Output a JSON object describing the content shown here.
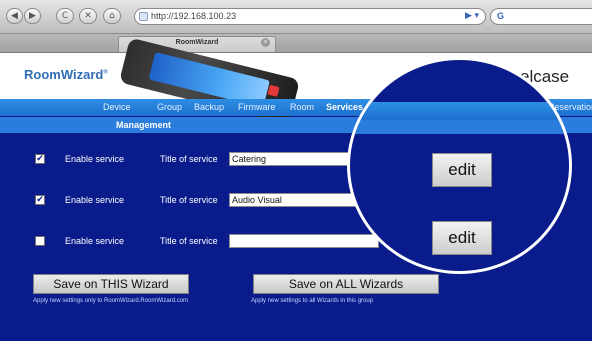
{
  "browser": {
    "back_glyph": "◀",
    "forward_glyph": "▶",
    "reload_glyph": "C",
    "stop_glyph": "✕",
    "home_glyph": "⌂",
    "url": "http://192.168.100.23",
    "go_glyph": "▶ ▾",
    "search_glyph": "G",
    "tab_title": "RoomWizard",
    "tab_close_glyph": "×"
  },
  "header": {
    "logo": "RoomWizard",
    "logo_mark": "®",
    "brand": "elcase"
  },
  "nav": {
    "items": [
      "Device",
      "Group",
      "Backup",
      "Firmware",
      "Room",
      "Services",
      "Reservations"
    ],
    "active": "Services",
    "sub_label": "Management"
  },
  "services": [
    {
      "checked": true,
      "check_glyph": "✔",
      "enable_label": "Enable service",
      "title_label": "Title of service",
      "value": "Catering"
    },
    {
      "checked": true,
      "check_glyph": "✔",
      "enable_label": "Enable service",
      "title_label": "Title of service",
      "value": "Audio Visual"
    },
    {
      "checked": false,
      "check_glyph": "",
      "enable_label": "Enable service",
      "title_label": "Title of service",
      "value": ""
    }
  ],
  "actions": {
    "save_this": "Save on THIS Wizard",
    "save_this_hint": "Apply new settings only to RoomWizard.RoomWizard.com",
    "save_all": "Save on ALL Wizards",
    "save_all_hint": "Apply new settings to all Wizards in this group"
  },
  "magnifier": {
    "edit1": "edit",
    "edit2": "edit"
  },
  "colors": {
    "page_bg": "#0a1c8c",
    "nav_bar": "#1d6fce",
    "logo": "#2e6db6"
  }
}
